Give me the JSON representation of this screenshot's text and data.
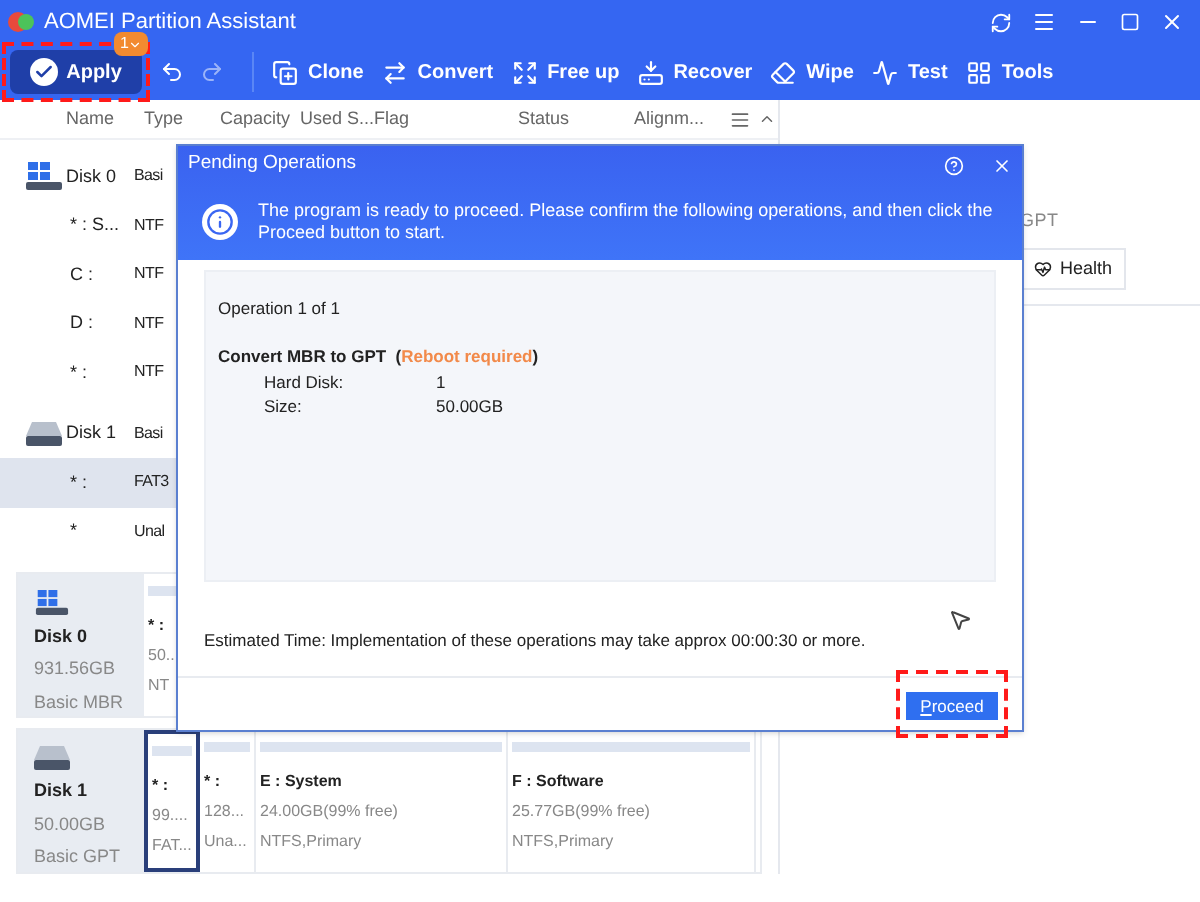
{
  "window": {
    "title": "AOMEI Partition Assistant"
  },
  "toolbar": {
    "apply": {
      "label": "Apply",
      "badge": "1",
      "highlighted": true
    },
    "tools": [
      {
        "label": "Clone",
        "kind": "clone"
      },
      {
        "label": "Convert",
        "kind": "convert"
      },
      {
        "label": "Free up",
        "kind": "freeup"
      },
      {
        "label": "Recover",
        "kind": "recover"
      },
      {
        "label": "Wipe",
        "kind": "wipe"
      },
      {
        "label": "Test",
        "kind": "test"
      },
      {
        "label": "Tools",
        "kind": "tools"
      }
    ]
  },
  "table": {
    "columns": [
      "Name",
      "Type",
      "Capacity",
      "Used S...",
      "Flag",
      "Status",
      "Alignm..."
    ],
    "rows": [
      {
        "kind": "system_disk",
        "name": "Disk 0",
        "type": "Basi",
        "selected": false
      },
      {
        "kind": "partition",
        "name": "* : S...",
        "type": "NTF",
        "selected": false
      },
      {
        "kind": "partition",
        "name": "C :",
        "type": "NTF",
        "selected": false
      },
      {
        "kind": "partition",
        "name": "D :",
        "type": "NTF",
        "selected": false
      },
      {
        "kind": "partition",
        "name": "* :",
        "type": "NTF",
        "selected": false
      },
      {
        "kind": "disk",
        "name": "Disk 1",
        "type": "Basi",
        "selected": false
      },
      {
        "kind": "partition",
        "name": "* :",
        "type": "FAT3",
        "selected": true
      },
      {
        "kind": "partition",
        "name": "*",
        "type": "Unal",
        "selected": false
      }
    ]
  },
  "disk_map": [
    {
      "kind": "system_disk",
      "name": "Disk 0",
      "capacity": "931.56GB",
      "style": "Basic MBR",
      "partitions": [
        {
          "name": "* :",
          "size": "50..",
          "fs": "NT",
          "selected": false
        }
      ]
    },
    {
      "kind": "disk",
      "name": "Disk 1",
      "capacity": "50.00GB",
      "style": "Basic GPT",
      "partitions": [
        {
          "name": "* :",
          "size": "99....",
          "fs": "FAT...",
          "selected": true
        },
        {
          "name": "* :",
          "size": "128...",
          "fs": "Una...",
          "selected": false
        },
        {
          "name": "E : System",
          "size": "24.00GB(99% free)",
          "fs": "NTFS,Primary",
          "selected": false
        },
        {
          "name": "F : Software",
          "size": "25.77GB(99% free)",
          "fs": "NTFS,Primary",
          "selected": false
        }
      ]
    }
  ],
  "right_panel": {
    "disk_style": "GPT",
    "health_button": "Health"
  },
  "dialog": {
    "title": "Pending Operations",
    "info": "The program is ready to proceed. Please confirm the following operations, and then click the Proceed button to start.",
    "operation_count": "Operation 1 of 1",
    "operation_title": [
      {
        "text": "Convert MBR to GPT  (",
        "kind": "plain"
      },
      {
        "text": "Reboot required",
        "kind": "warning"
      },
      {
        "text": ")",
        "kind": "plain"
      }
    ],
    "details": [
      {
        "label": "Hard Disk:",
        "value": "1"
      },
      {
        "label": "Size:",
        "value": "50.00GB"
      }
    ],
    "estimate": "Estimated Time: Implementation of these operations may take approx 00:00:30 or more.",
    "proceed": {
      "label": "Proceed",
      "highlighted": true
    }
  }
}
